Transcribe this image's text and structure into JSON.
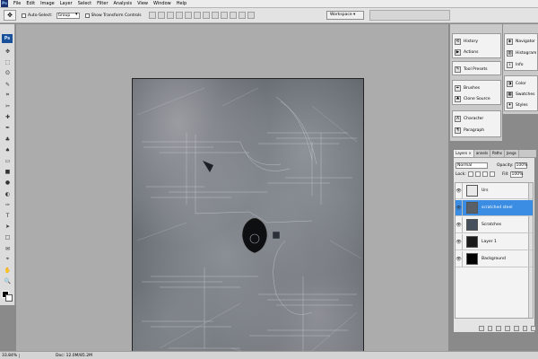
{
  "app": {
    "logo": "Ps",
    "menu": [
      "File",
      "Edit",
      "Image",
      "Layer",
      "Select",
      "Filter",
      "Analysis",
      "View",
      "Window",
      "Help"
    ]
  },
  "options": {
    "tool_glyph": "✥",
    "auto_select_label": "Auto-Select:",
    "auto_select_value": "Group",
    "show_transform_label": "Show Transform Controls",
    "workspace_label": "Workspace ▾"
  },
  "tools": {
    "icons": [
      "move-tool-icon",
      "marquee-tool-icon",
      "lasso-tool-icon",
      "quick-select-tool-icon",
      "crop-tool-icon",
      "slice-tool-icon",
      "healing-brush-icon",
      "brush-tool-icon",
      "clone-stamp-icon",
      "history-brush-icon",
      "eraser-tool-icon",
      "gradient-tool-icon",
      "blur-tool-icon",
      "dodge-tool-icon",
      "pen-tool-icon",
      "type-tool-icon",
      "path-select-icon",
      "shape-tool-icon",
      "notes-tool-icon",
      "eyedropper-tool-icon",
      "hand-tool-icon",
      "zoom-tool-icon"
    ],
    "glyphs": [
      "✥",
      "⬚",
      "ʘ",
      "✎",
      "⌗",
      "✂",
      "✚",
      "✒",
      "♣",
      "♠",
      "▭",
      "■",
      "●",
      "◐",
      "✑",
      "T",
      "➤",
      "□",
      "✉",
      "⌖",
      "✋",
      "🔍"
    ]
  },
  "panels_left": [
    {
      "id": "history",
      "label": "History",
      "glyph": "⟲"
    },
    {
      "id": "actions",
      "label": "Actions",
      "glyph": "▶"
    },
    {
      "id": "tool-presets",
      "label": "Tool Presets",
      "glyph": "✎"
    },
    {
      "id": "brushes",
      "label": "Brushes",
      "glyph": "✒"
    },
    {
      "id": "clone-source",
      "label": "Clone Source",
      "glyph": "♣"
    },
    {
      "id": "character",
      "label": "Character",
      "glyph": "A"
    },
    {
      "id": "paragraph",
      "label": "Paragraph",
      "glyph": "¶"
    }
  ],
  "panels_right": [
    {
      "id": "navigator",
      "label": "Navigator",
      "glyph": "◈"
    },
    {
      "id": "histogram",
      "label": "Histogram",
      "glyph": "▥"
    },
    {
      "id": "info",
      "label": "Info",
      "glyph": "i"
    },
    {
      "id": "color",
      "label": "Color",
      "glyph": "◑"
    },
    {
      "id": "swatches",
      "label": "Swatches",
      "glyph": "▦"
    },
    {
      "id": "styles",
      "label": "Styles",
      "glyph": "✦"
    }
  ],
  "layers_panel": {
    "tabs": [
      "Layers ×",
      "annels",
      "Paths",
      "Jongs"
    ],
    "blend_mode": "Normal",
    "opacity_label": "Opacity:",
    "opacity_value": "100%",
    "lock_label": "Lock:",
    "fill_label": "Fill:",
    "fill_value": "100%",
    "layers": [
      {
        "name": "Urs",
        "thumb": "#e9e9e9",
        "selected": false
      },
      {
        "name": "scratched steel",
        "thumb": "#5a6068",
        "selected": true
      },
      {
        "name": "Scratches",
        "thumb": "#46505c",
        "selected": false
      },
      {
        "name": "Layer 1",
        "thumb": "#1b1b1b",
        "selected": false
      },
      {
        "name": "Background",
        "thumb": "#000000",
        "selected": false
      }
    ]
  },
  "status": {
    "zoom": "33.84%",
    "doc": "Doc: 12.0M/85.2M"
  },
  "colors": {
    "selection": "#3b8de3",
    "foreground": "#000000",
    "background": "#ffffff"
  }
}
